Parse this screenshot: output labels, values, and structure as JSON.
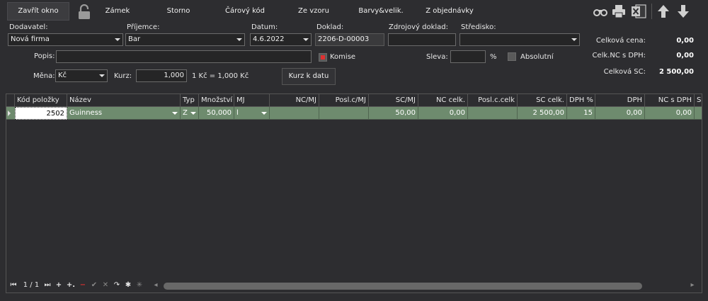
{
  "toolbar": {
    "close_label": "Zavřít okno",
    "lock_label": "Zámek",
    "cancel_label": "Storno",
    "barcode_label": "Čárový kód",
    "from_template_label": "Ze vzoru",
    "colors_sizes_label": "Barvy&velik.",
    "from_order_label": "Z objednávky"
  },
  "form": {
    "supplier": {
      "label": "Dodavatel:",
      "value": "Nová firma"
    },
    "recipient": {
      "label": "Příjemce:",
      "value": "Bar"
    },
    "date": {
      "label": "Datum:",
      "value": "4.6.2022"
    },
    "document": {
      "label": "Doklad:",
      "value": "2206-D-00003"
    },
    "source_document": {
      "label": "Zdrojový doklad:",
      "value": ""
    },
    "center": {
      "label": "Středisko:",
      "value": ""
    },
    "description": {
      "label": "Popis:",
      "value": ""
    },
    "consignment": {
      "label": "Komise"
    },
    "discount": {
      "label": "Sleva:",
      "value": "",
      "unit": "%"
    },
    "absolute": {
      "label": "Absolutní"
    },
    "currency": {
      "label": "Měna:",
      "value": "Kč"
    },
    "rate": {
      "label": "Kurz:",
      "value": "1,000",
      "info": "1 Kč = 1,000 Kč"
    },
    "rate_button": "Kurz k datu"
  },
  "totals": {
    "total_price_label": "Celková cena:",
    "total_price": "0,00",
    "total_nc_vat_label": "Celk.NC s DPH:",
    "total_nc_vat": "0,00",
    "total_sc_label": "Celková SC:",
    "total_sc": "2 500,00"
  },
  "grid": {
    "columns": [
      "Kód položky",
      "Název",
      "Typ",
      "Množství",
      "MJ",
      "NC/MJ",
      "Posl.c/MJ",
      "SC/MJ",
      "NC celk.",
      "Posl.c.celk",
      "SC celk.",
      "DPH %",
      "DPH",
      "NC s DPH",
      "S"
    ],
    "rows": [
      {
        "code": "2502",
        "name": "Guinness",
        "type": "Z",
        "qty": "50,000",
        "unit": "l",
        "nc_mj": "",
        "last_mj": "",
        "sc_mj": "50,00",
        "nc_total": "0,00",
        "last_total": "",
        "sc_total": "2 500,00",
        "vat_pct": "15",
        "vat": "0,00",
        "nc_vat": "0,00"
      }
    ]
  },
  "navigator": {
    "position": "1 / 1"
  },
  "colors": {
    "accent_row": "#6e8b6e",
    "background": "#2d2d30",
    "consignment_red": "#e03030"
  }
}
